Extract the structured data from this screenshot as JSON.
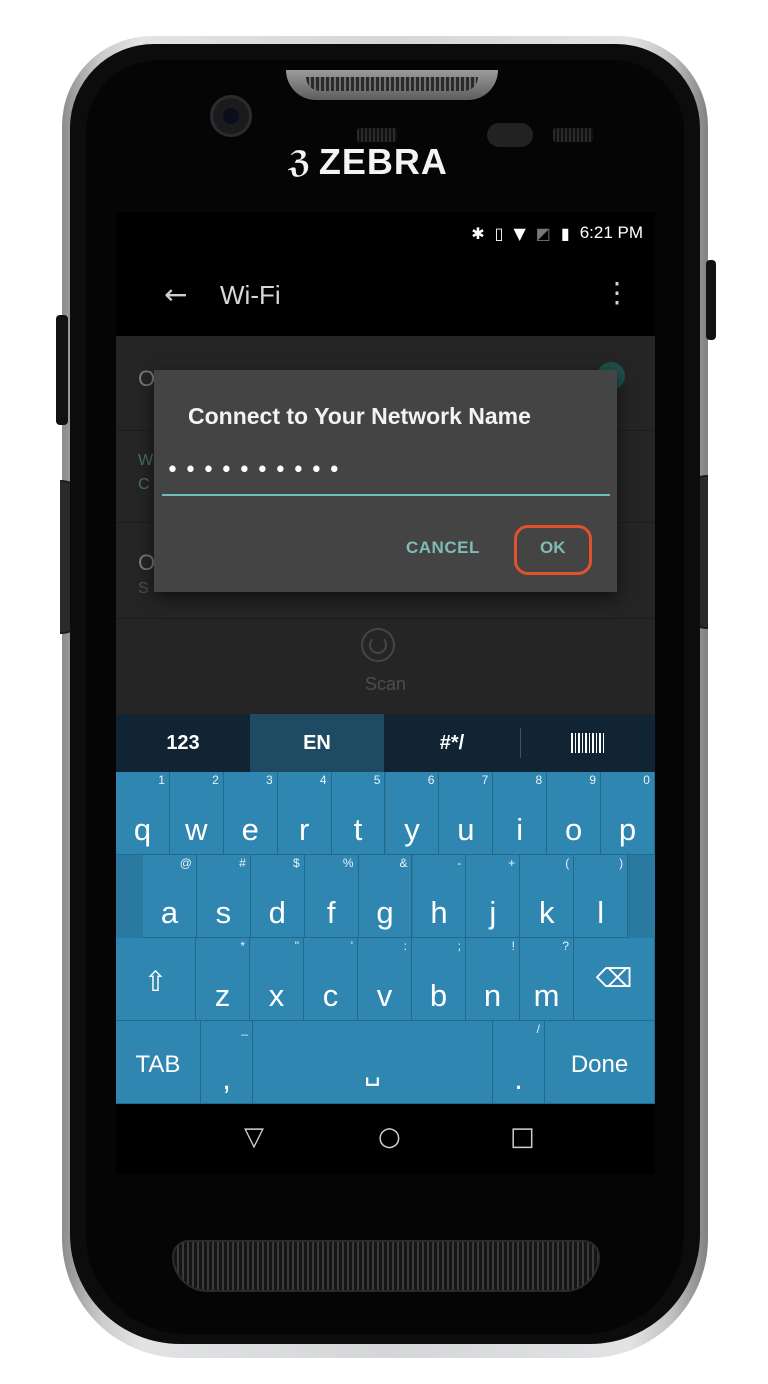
{
  "device": {
    "brand": "ZEBRA",
    "logo_icon": "zebra-head-icon"
  },
  "status_bar": {
    "time": "6:21 PM",
    "icons": [
      "bluetooth-icon",
      "vibrate-icon",
      "wifi-icon",
      "no-sim-icon",
      "battery-charging-icon"
    ]
  },
  "app_bar": {
    "title": "Wi-Fi",
    "back_icon": "arrow-back-icon",
    "menu_icon": "more-vert-icon"
  },
  "wifi_list": {
    "rows": [
      {
        "title": "O",
        "subtitle": ""
      },
      {
        "title": "W",
        "subtitle": "C"
      },
      {
        "title": "O",
        "subtitle": "S"
      }
    ],
    "toggle_on": true
  },
  "scan": {
    "label": "Scan",
    "icon": "refresh-icon"
  },
  "dialog": {
    "title": "Connect to Your Network Name",
    "password_value": "••••••••••",
    "cancel_label": "CANCEL",
    "ok_label": "OK",
    "highlight_color": "#e0522e"
  },
  "keyboard": {
    "tabs": [
      {
        "label": "123",
        "active": false
      },
      {
        "label": "EN",
        "active": true
      },
      {
        "label": "#*/",
        "active": false
      },
      {
        "label": "",
        "icon": "barcode-icon",
        "active": false
      }
    ],
    "rows": [
      [
        {
          "m": "q",
          "h": "1"
        },
        {
          "m": "w",
          "h": "2"
        },
        {
          "m": "e",
          "h": "3"
        },
        {
          "m": "r",
          "h": "4"
        },
        {
          "m": "t",
          "h": "5"
        },
        {
          "m": "y",
          "h": "6"
        },
        {
          "m": "u",
          "h": "7"
        },
        {
          "m": "i",
          "h": "8"
        },
        {
          "m": "o",
          "h": "9"
        },
        {
          "m": "p",
          "h": "0"
        }
      ],
      [
        {
          "m": "a",
          "h": "@"
        },
        {
          "m": "s",
          "h": "#"
        },
        {
          "m": "d",
          "h": "$"
        },
        {
          "m": "f",
          "h": "%"
        },
        {
          "m": "g",
          "h": "&"
        },
        {
          "m": "h",
          "h": "-"
        },
        {
          "m": "j",
          "h": "+"
        },
        {
          "m": "k",
          "h": "("
        },
        {
          "m": "l",
          "h": ")"
        }
      ],
      [
        {
          "m": "⇧",
          "h": "",
          "name": "shift"
        },
        {
          "m": "z",
          "h": "*"
        },
        {
          "m": "x",
          "h": "\""
        },
        {
          "m": "c",
          "h": "'"
        },
        {
          "m": "v",
          "h": ":"
        },
        {
          "m": "b",
          "h": ";"
        },
        {
          "m": "n",
          "h": "!"
        },
        {
          "m": "m",
          "h": "?"
        },
        {
          "m": "⌫",
          "h": "",
          "name": "backspace"
        }
      ],
      [
        {
          "m": "TAB",
          "h": "",
          "name": "tab"
        },
        {
          "m": ",",
          "h": "_"
        },
        {
          "m": "␣",
          "h": "",
          "name": "space"
        },
        {
          "m": ".",
          "h": "/"
        },
        {
          "m": "Done",
          "h": "",
          "name": "done"
        }
      ]
    ],
    "colors": {
      "key": "#2f86b0",
      "background": "#2a79a0",
      "tab_bar": "#102433",
      "active_tab": "#1f4a63"
    }
  },
  "nav_bar": {
    "icons": [
      "back-triangle-icon",
      "home-circle-icon",
      "recents-square-icon"
    ]
  }
}
